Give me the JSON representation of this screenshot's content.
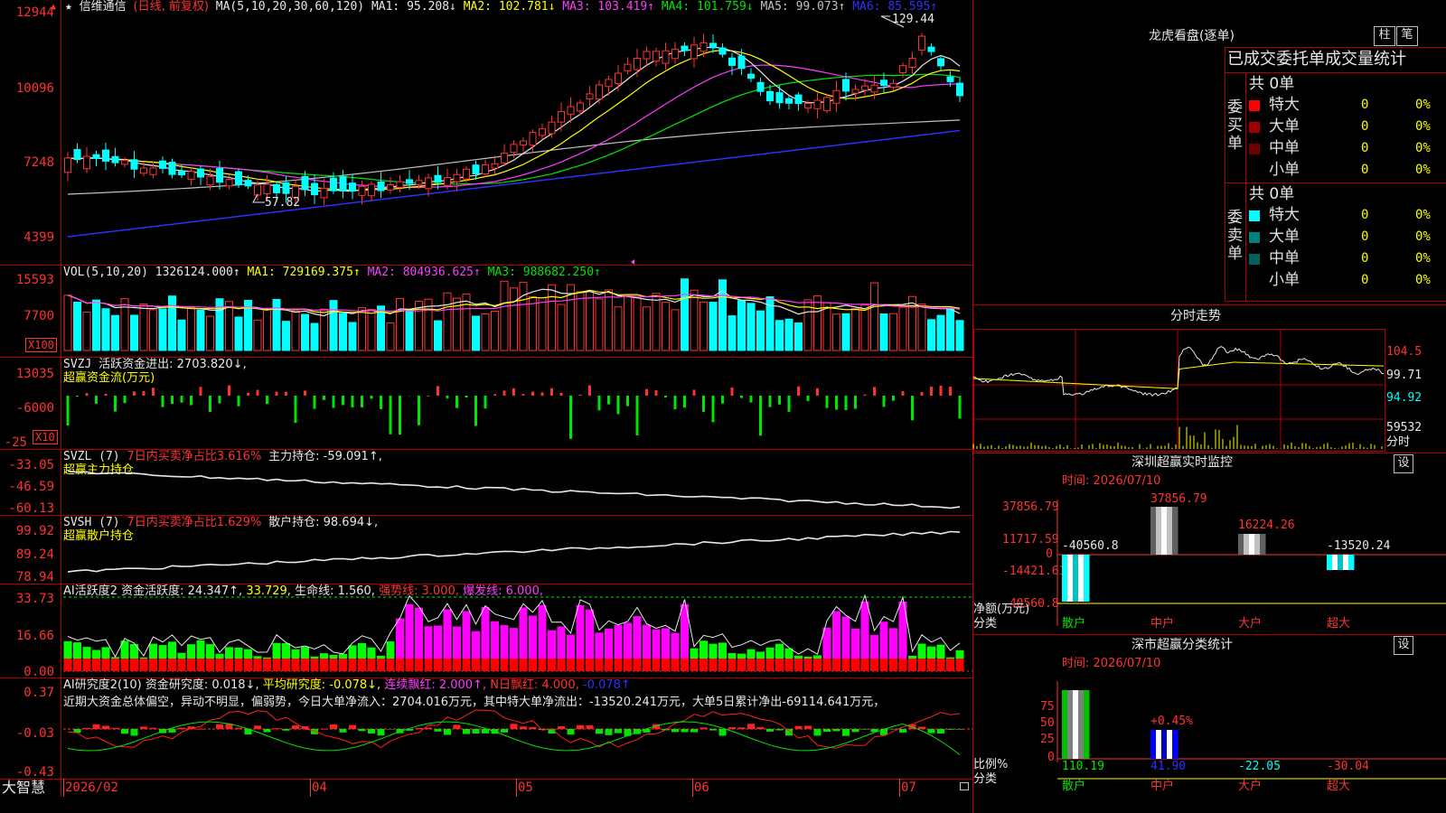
{
  "stock": {
    "name": "信维通信",
    "mode": "(日线, 前复权)"
  },
  "main": {
    "ma_params": "MA(5,10,20,30,60,120)",
    "ma1": "MA1: 95.208↓",
    "ma2": "MA2: 102.781↓",
    "ma3": "MA3: 103.419↑",
    "ma4": "MA4: 101.759↓",
    "ma5": "MA5: 99.073↑",
    "ma6": "MA6: 85.595↑",
    "y_labels": [
      "12944",
      "10096",
      "7248",
      "4399"
    ],
    "high_mark": "129.44",
    "low_mark": "57.82"
  },
  "vol": {
    "params": "VOL(5,10,20)",
    "value": "1326124.000↑",
    "ma1": "MA1: 729169.375↑",
    "ma2": "MA2: 804936.625↑",
    "ma3": "MA3: 988682.250↑",
    "y_labels": [
      "15593",
      "7700"
    ],
    "unit": "X100"
  },
  "svzj": {
    "name": "SVZJ",
    "label": "活跃资金进出: 2703.820↓,",
    "sub": "超赢资金流(万元)",
    "y_labels": [
      "13035",
      "-6000",
      "-25"
    ],
    "unit": "X10"
  },
  "svzl": {
    "name": "SVZL (7)",
    "ratio": "7日内买卖净占比3.616%",
    "hold": "主力持仓: -59.091↑,",
    "sub": "超赢主力持仓",
    "y_labels": [
      "-33.05",
      "-46.59",
      "-60.13"
    ]
  },
  "svsh": {
    "name": "SVSH (7)",
    "ratio": "7日内买卖净占比1.629%",
    "hold": "散户持仓: 98.694↓,",
    "sub": "超赢散户持仓",
    "y_labels": [
      "99.92",
      "89.24",
      "78.94"
    ]
  },
  "ai1": {
    "name": "AI活跃度2",
    "active": "资金活跃度: 24.347↑,",
    "v2": "33.729,",
    "life": "生命线: 1.560,",
    "strong": "强势线: 3.000,",
    "burst": "爆发线: 6.000,",
    "y_labels": [
      "33.73",
      "16.66",
      "0.00"
    ]
  },
  "ai2": {
    "name": "AI研究度2(10)",
    "research": "资金研究度: 0.018↓,",
    "avg": "平均研究度: -0.078↓,",
    "lian": "连续飘红: 2.000↑,",
    "nday": "N日飘红: 4.000,",
    "last": "-0.078↑",
    "note": "近期大资金总体偏空，异动不明显，偏弱势，今日大单净流入：2704.016万元，其中特大单净流出：-13520.241万元，大单5日累计净出-69114.641万元，",
    "y_labels": [
      "0.37",
      "-0.03",
      "-0.43"
    ]
  },
  "xaxis": {
    "labels": [
      "2026/02",
      "04",
      "05",
      "06",
      "07"
    ],
    "brand": "大智慧"
  },
  "lhb": {
    "title": "龙虎看盘(逐单)",
    "btn1": "柱",
    "btn2": "笔",
    "header": "已成交委托单成交量统计",
    "buy": {
      "label": "委买单",
      "total": "共 0单",
      "rows": [
        {
          "name": "特大",
          "v": "0",
          "p": "0%",
          "c": "#ff0000"
        },
        {
          "name": "大单",
          "v": "0",
          "p": "0%",
          "c": "#a00000"
        },
        {
          "name": "中单",
          "v": "0",
          "p": "0%",
          "c": "#700000"
        },
        {
          "name": "小单",
          "v": "0",
          "p": "0%",
          "c": "#000000"
        }
      ]
    },
    "sell": {
      "label": "委卖单",
      "total": "共 0单",
      "rows": [
        {
          "name": "特大",
          "v": "0",
          "p": "0%",
          "c": "#00ffff"
        },
        {
          "name": "大单",
          "v": "0",
          "p": "0%",
          "c": "#008080"
        },
        {
          "name": "中单",
          "v": "0",
          "p": "0%",
          "c": "#006060"
        },
        {
          "name": "小单",
          "v": "0",
          "p": "0%",
          "c": "#000000"
        }
      ]
    }
  },
  "fenshi": {
    "title": "分时走势",
    "y_labels": [
      "104.5",
      "99.71",
      "94.92"
    ],
    "vol_label": "59532",
    "vol_unit": "分时"
  },
  "monitor": {
    "title": "深圳超赢实时监控",
    "btn": "设",
    "time": "时间: 2026/07/10",
    "y_labels": [
      "37856.79",
      "11717.59",
      "0",
      "-14421.61",
      "-40560.8"
    ],
    "values": [
      "-40560.8",
      "37856.79",
      "16224.26",
      "-13520.24"
    ],
    "net_label": "净额(万元)",
    "cat_label": "分类",
    "cats": [
      "散户",
      "中户",
      "大户",
      "超大"
    ]
  },
  "stats": {
    "title": "深市超赢分类统计",
    "btn": "设",
    "time": "时间: 2026/07/10",
    "y_labels": [
      "75",
      "50",
      "25",
      "0"
    ],
    "pct": "+0.45%",
    "values": [
      "110.19",
      "41.90",
      "-22.05",
      "-30.04"
    ],
    "ratio_label": "比例%",
    "cat_label": "分类",
    "cats": [
      "散户",
      "中户",
      "大户",
      "超大"
    ]
  }
}
